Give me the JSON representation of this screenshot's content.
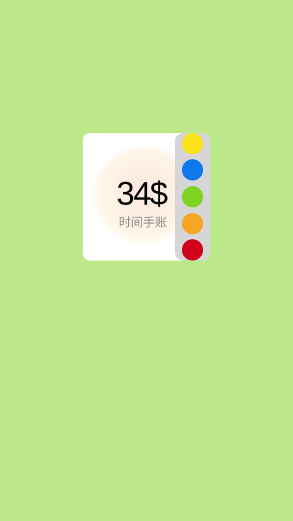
{
  "widget": {
    "amount": "34$",
    "subtitle": "时间手账"
  },
  "palette": {
    "colors": [
      "#f9e21a",
      "#0f78ee",
      "#7ed321",
      "#f6a623",
      "#d0021b"
    ]
  },
  "theme": {
    "background": "#bce88a"
  }
}
